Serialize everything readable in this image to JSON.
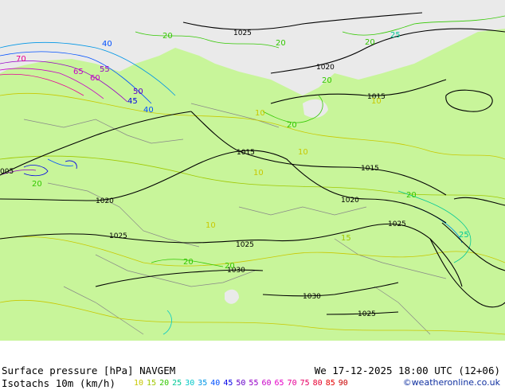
{
  "map": {
    "isobar_labels": {
      "i1025a": "1025",
      "i1020a": "1020",
      "i1015a": "1015",
      "i1015b": "1015",
      "i1015c": "1015",
      "i1020b": "1020",
      "i1020c": "1020",
      "i1025b": "1025",
      "i1025c": "1025",
      "i1025d": "1025",
      "i1030a": "1030",
      "i1030b": "1030",
      "i1025e": "1025",
      "i1005": "005"
    },
    "isotach_labels": {
      "t40a": "40",
      "t20a": "20",
      "t20b": "20",
      "t25a": "25",
      "t20c": "20",
      "t70": "70",
      "t65": "65",
      "t60": "60",
      "t55": "55",
      "t50": "50",
      "t45": "45",
      "t40b": "40",
      "t20d": "20",
      "t20e": "20",
      "t10a": "10",
      "t10b": "10",
      "t10c": "10",
      "t10d": "10",
      "t20f": "20",
      "t15a": "15",
      "t20g": "20",
      "t20h": "20",
      "t20i": "20",
      "t10e": "10",
      "t25b": "25"
    },
    "colors": {
      "land": "#c8f59a",
      "sea": "#eaeaea",
      "isobar": "#000000"
    }
  },
  "footer": {
    "title_left": "Surface pressure [hPa] NAVGEM",
    "title_right": "We 17-12-2025 18:00 UTC (12+06)",
    "legend_label": "Isotachs 10m (km/h)",
    "legend_values": [
      "10",
      "15",
      "20",
      "25",
      "30",
      "35",
      "40",
      "45",
      "50",
      "55",
      "60",
      "65",
      "70",
      "75",
      "80",
      "85",
      "90"
    ],
    "legend_colors": [
      "#c8c800",
      "#a0c800",
      "#32c800",
      "#00c896",
      "#00c8c8",
      "#0096e6",
      "#0050ff",
      "#0000e6",
      "#6400c8",
      "#9600c8",
      "#c800c8",
      "#e600c8",
      "#e60096",
      "#e60064",
      "#e60032",
      "#e60000",
      "#c80000"
    ],
    "credit": "©weatheronline.co.uk"
  }
}
